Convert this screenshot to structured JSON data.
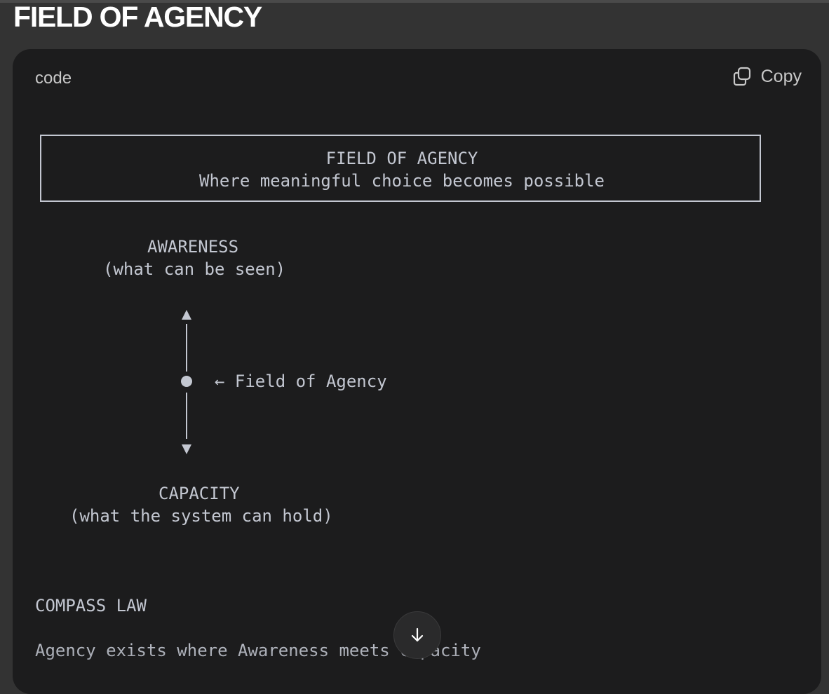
{
  "page": {
    "title": "FIELD OF AGENCY"
  },
  "code_block": {
    "language_label": "code",
    "copy_label": "Copy",
    "banner": {
      "title": "FIELD OF AGENCY",
      "subtitle": "Where meaningful choice becomes possible"
    },
    "awareness": {
      "label": "AWARENESS",
      "description": "(what can be seen)"
    },
    "axis_pointer": "← Field of Agency",
    "capacity": {
      "label": "CAPACITY",
      "description": "(what the system can hold)"
    },
    "law": {
      "heading": "COMPASS LAW",
      "text": "Agency exists where Awareness meets Capacity"
    }
  },
  "icons": {
    "copy": "copy-icon",
    "scroll_down": "arrow-down-icon",
    "axis": "double-arrow-axis-icon"
  },
  "colors": {
    "page_background": "#333333",
    "card_background": "#1c1c1d",
    "code_text": "#c3c7d1",
    "title_text": "#ffffff"
  }
}
